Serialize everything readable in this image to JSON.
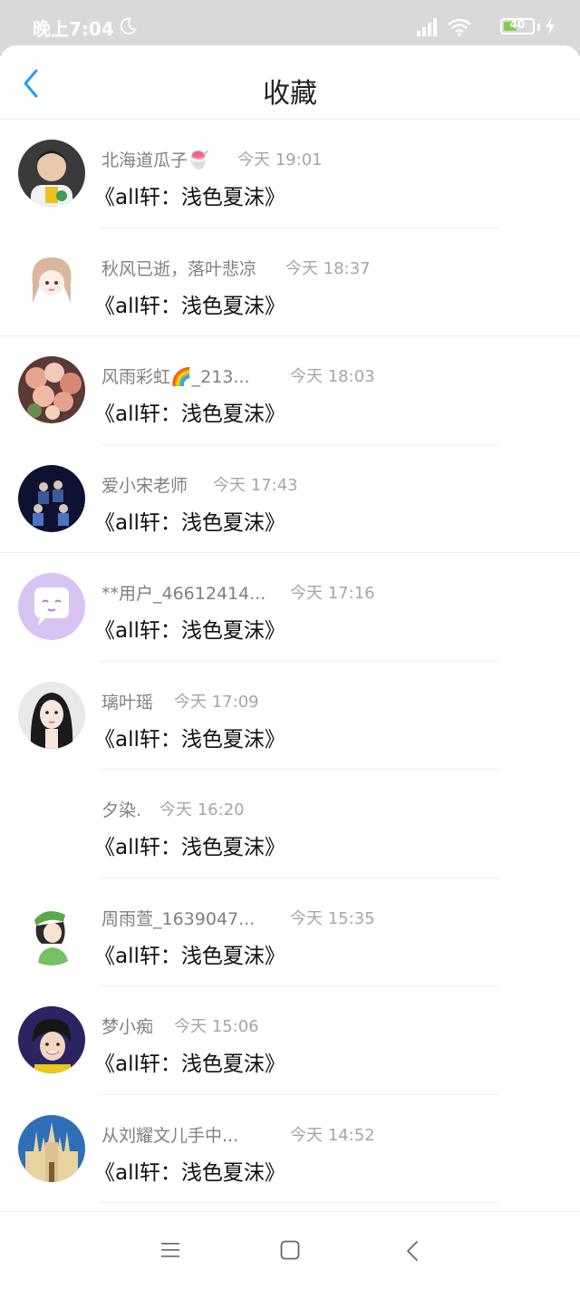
{
  "status_bar": {
    "time": "晚上7:04",
    "battery": "40"
  },
  "header": {
    "title": "收藏"
  },
  "items": [
    {
      "username": "北海道瓜子🍧",
      "time": "今天 19:01",
      "title": "《all轩：浅色夏沫》",
      "avatar": "avatar-boy-green"
    },
    {
      "username": "秋风已逝，落叶悲凉",
      "time": "今天 18:37",
      "title": "《all轩：浅色夏沫》",
      "avatar": "avatar-anime-girl"
    },
    {
      "username": "风雨彩虹🌈_213...",
      "time": "今天 18:03",
      "title": "《all轩：浅色夏沫》",
      "avatar": "avatar-flowers"
    },
    {
      "username": "爱小宋老师",
      "time": "今天 17:43",
      "title": "《all轩：浅色夏沫》",
      "avatar": "avatar-group"
    },
    {
      "username": "**用户_46612414...",
      "time": "今天 17:16",
      "title": "《all轩：浅色夏沫》",
      "avatar": "avatar-default-chat"
    },
    {
      "username": "璃叶瑶",
      "time": "今天 17:09",
      "title": "《all轩：浅色夏沫》",
      "avatar": "avatar-girl"
    },
    {
      "username": "夕染.",
      "time": "今天 16:20",
      "title": "《all轩：浅色夏沫》",
      "avatar": "avatar-blank"
    },
    {
      "username": "周雨萱_1639047...",
      "time": "今天 15:35",
      "title": "《all轩：浅色夏沫》",
      "avatar": "avatar-cartoon-green"
    },
    {
      "username": "梦小痴",
      "time": "今天 15:06",
      "title": "《all轩：浅色夏沫》",
      "avatar": "avatar-smiling-girl"
    },
    {
      "username": "从刘耀文儿手中...",
      "time": "今天 14:52",
      "title": "《all轩：浅色夏沫》",
      "avatar": "avatar-cathedral"
    }
  ],
  "colors": {
    "accent": "#2b9af3",
    "status_bar": "#d9d9d9"
  }
}
